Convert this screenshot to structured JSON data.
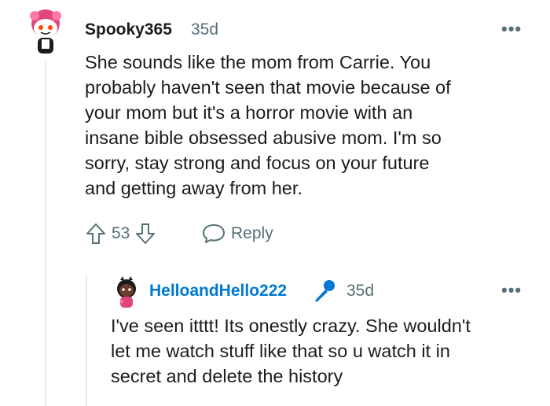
{
  "comment": {
    "username": "Spooky365",
    "age": "35d",
    "text_lines": [
      "She sounds like the mom from Carrie. You",
      "probably haven't seen that movie because of",
      "your mom but it's a horror movie with an",
      "insane bible obsessed abusive mom. I'm so",
      "sorry, stay strong and focus on your future",
      "and getting away from her."
    ],
    "vote_count": "53",
    "reply_label": "Reply",
    "more_label": "•••"
  },
  "reply": {
    "username": "HelloandHello222",
    "age": "35d",
    "text_lines": [
      "I've seen itttt! Its onestly crazy. She wouldn't",
      "let me watch stuff like that so u watch it in",
      "secret and delete the history"
    ],
    "more_label": "•••"
  },
  "colors": {
    "username_reply": "#0079d3",
    "meta": "#576f76",
    "thread_line": "#e5ebee",
    "avatar1_hair": "#e0457b",
    "avatar2_skin": "#6b3d2a"
  },
  "icons": [
    "reddit-snoo-avatar",
    "upvote-arrow-icon",
    "downvote-arrow-icon",
    "comment-bubble-icon",
    "microphone-icon"
  ]
}
